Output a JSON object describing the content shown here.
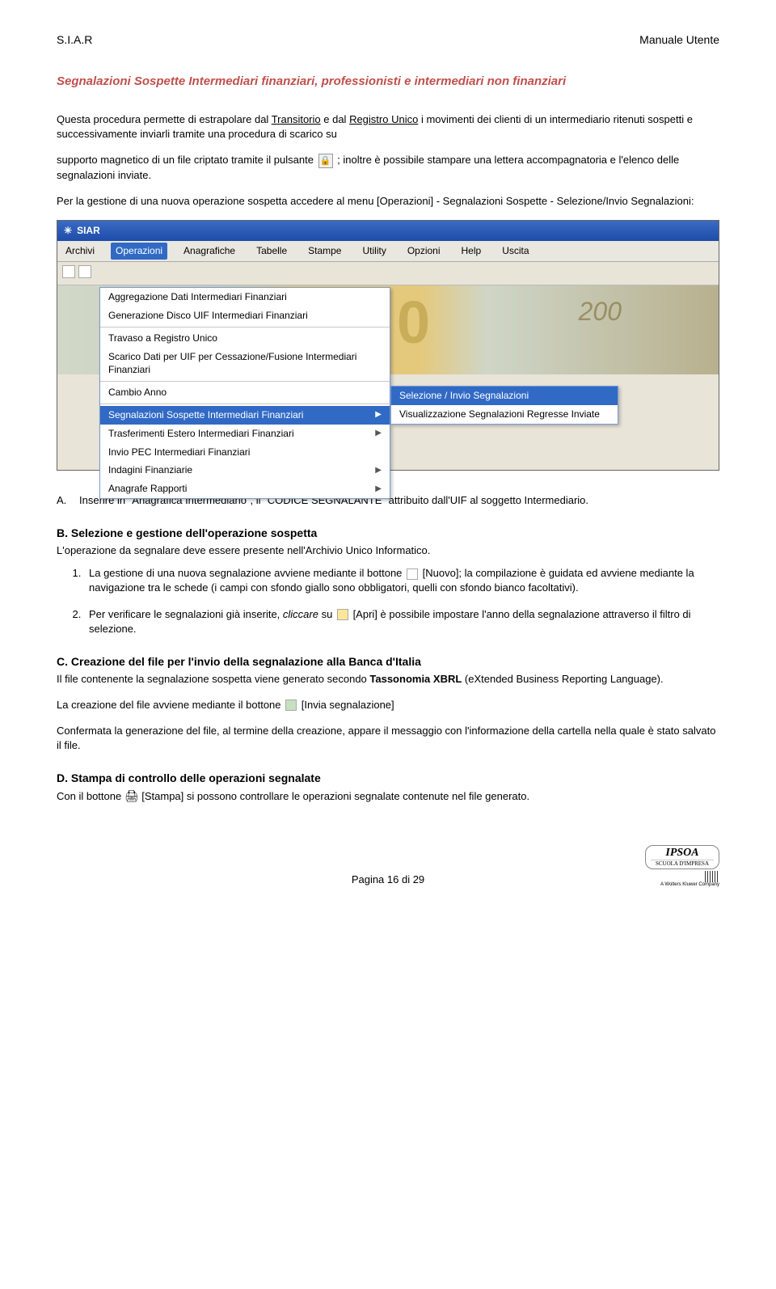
{
  "header": {
    "left": "S.I.A.R",
    "right": "Manuale Utente"
  },
  "title": "Segnalazioni Sospette Intermediari finanziari, professionisti e intermediari non finanziari",
  "intro": {
    "p1a": "Questa procedura permette di estrapolare dal ",
    "p1u1": "Transitorio",
    "p1b": " e dal ",
    "p1u2": "Registro Unico",
    "p1c": " i movimenti dei clienti di un intermediario ritenuti sospetti e successivamente inviarli tramite una procedura di scarico su",
    "p2a": "supporto magnetico di un file criptato tramite il pulsante ",
    "p2b": " ; inoltre è possibile stampare  una lettera accompagnatoria e l'elenco delle segnalazioni inviate.",
    "p3": "Per la gestione di una nuova operazione sospetta accedere al menu [Operazioni] - Segnalazioni Sospette - Selezione/Invio Segnalazioni:"
  },
  "ss": {
    "title": "SIAR",
    "menubar": [
      "Archivi",
      "Operazioni",
      "Anagrafiche",
      "Tabelle",
      "Stampe",
      "Utility",
      "Opzioni",
      "Help",
      "Uscita"
    ],
    "dropdown": {
      "g1": [
        "Aggregazione Dati Intermediari Finanziari",
        "Generazione Disco UIF Intermediari Finanziari"
      ],
      "g2": [
        "Travaso a Registro Unico",
        "Scarico Dati per UIF per Cessazione/Fusione Intermediari Finanziari"
      ],
      "g3": [
        "Cambio Anno"
      ],
      "g4": [
        {
          "label": "Segnalazioni Sospette Intermediari Finanziari",
          "hl": true,
          "sub": true
        },
        {
          "label": "Trasferimenti Estero Intermediari Finanziari",
          "sub": true
        },
        {
          "label": "Invio PEC Intermediari Finanziari",
          "sub": false
        },
        {
          "label": "Indagini Finanziarie",
          "sub": true
        },
        {
          "label": "Anagrafe Rapporti",
          "sub": true
        }
      ]
    },
    "submenu": [
      "Selezione / Invio Segnalazioni",
      "Visualizzazione Segnalazioni Regresse Inviate"
    ],
    "watermark_big": "0",
    "watermark_small": "200"
  },
  "list_a": {
    "label": "A.",
    "text": "Inserire in \"Anagrafica Intermediario\", il \"CODICE SEGNALANTE\" attribuito dall'UIF al soggetto Intermediario."
  },
  "section_b": {
    "heading": "B. Selezione e gestione dell'operazione sospetta",
    "lead": "L'operazione da segnalare deve essere presente nell'Archivio Unico Informatico.",
    "items": [
      "La gestione di una nuova segnalazione avviene mediante il bottone  [Nuovo]; la compilazione è guidata ed avviene mediante la navigazione tra le schede (i campi con sfondo giallo sono obbligatori, quelli con sfondo bianco facoltativi).",
      "Per verificare le segnalazioni già inserite, cliccare su  [Apri] è possibile impostare l'anno della segnalazione attraverso il filtro di selezione."
    ]
  },
  "section_c": {
    "heading": "C. Creazione del file per l'invio della segnalazione alla Banca d'Italia",
    "p1a": "Il file contenente la segnalazione sospetta viene generato secondo ",
    "p1b": "Tassonomia XBRL",
    "p1c": " (eXtended Business Reporting Language).",
    "p2a": "La creazione del file avviene mediante il bottone ",
    "p2b": " [Invia segnalazione]",
    "p3": "Confermata la generazione del file, al termine della creazione, appare il messaggio con l'informazione della cartella nella quale è stato salvato il file."
  },
  "section_d": {
    "heading": "D. Stampa di controllo delle operazioni segnalate",
    "p1a": "Con il bottone ",
    "p1b": " [Stampa] si possono controllare le operazioni segnalate contenute nel file generato."
  },
  "footer": {
    "page": "Pagina 16 di 29",
    "logo_top": "IPSOA",
    "logo_sub": "SCUOLA D'IMPRESA",
    "wk": "A Wolters Kluwer Company"
  }
}
